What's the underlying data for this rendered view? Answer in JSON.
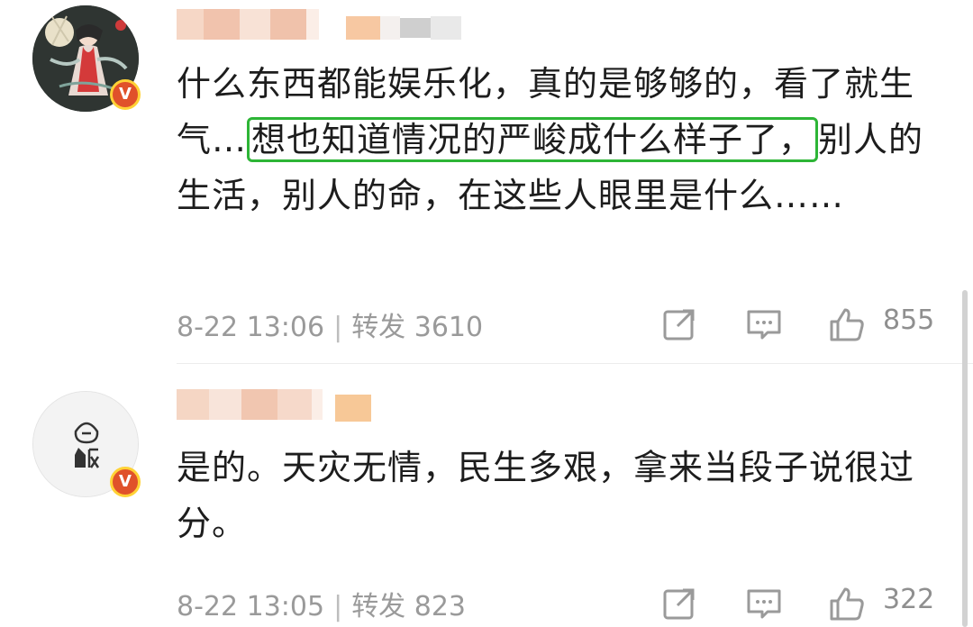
{
  "comments": [
    {
      "text_before": "什么东西都能娱乐化，真的是够够的，看了就生气…",
      "text_highlight": "想也知道情况的严峻成什么样子了，",
      "text_after": "别人的生活，别人的命，在这些人眼里是什么……",
      "date": "8-22 13:06",
      "separator": "|",
      "repost_label": "转发",
      "repost_count": "3610",
      "like_count": "855",
      "verified_badge": "V",
      "avatar_icon": "illustrated-girl-avatar"
    },
    {
      "text": "是的。天灾无情，民生多艰，拿来当段子说很过分。",
      "date": "8-22 13:05",
      "separator": "|",
      "repost_label": "转发",
      "repost_count": "823",
      "like_count": "322",
      "verified_badge": "V",
      "avatar_icon": "rice-character-avatar"
    }
  ],
  "colors": {
    "highlight_border": "#2db536",
    "badge": "#e0512a",
    "badge_ring": "#ffd236",
    "meta_text": "#9a9a9a"
  },
  "icons": [
    "share-icon",
    "comment-icon",
    "like-icon"
  ]
}
